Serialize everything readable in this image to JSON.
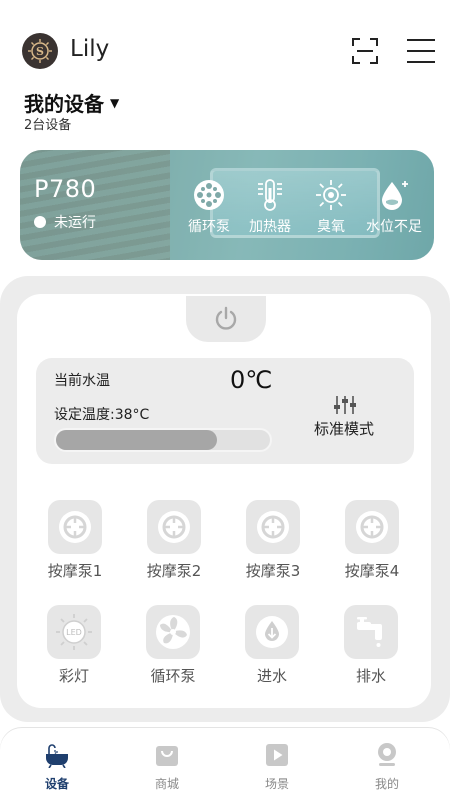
{
  "header": {
    "username": "Lily",
    "device_title": "我的设备",
    "device_count": "2台设备"
  },
  "banner": {
    "model": "P780",
    "status": "未运行",
    "stats": [
      {
        "label": "循环泵",
        "icon": "circulation-pump-icon"
      },
      {
        "label": "加热器",
        "icon": "heater-icon"
      },
      {
        "label": "臭氧",
        "icon": "ozone-icon"
      },
      {
        "label": "水位不足",
        "icon": "water-level-icon"
      }
    ]
  },
  "temperature": {
    "current_label": "当前水温",
    "current_value": "0℃",
    "set_label": "设定温度:38°C",
    "set_progress": 0.75,
    "mode_label": "标准模式"
  },
  "controls": [
    {
      "label": "按摩泵1",
      "icon": "massage-pump-icon"
    },
    {
      "label": "按摩泵2",
      "icon": "massage-pump-icon"
    },
    {
      "label": "按摩泵3",
      "icon": "massage-pump-icon"
    },
    {
      "label": "按摩泵4",
      "icon": "massage-pump-icon"
    },
    {
      "label": "彩灯",
      "icon": "led-light-icon",
      "badge": "LED"
    },
    {
      "label": "循环泵",
      "icon": "fan-icon"
    },
    {
      "label": "进水",
      "icon": "water-in-icon"
    },
    {
      "label": "排水",
      "icon": "drain-icon"
    }
  ],
  "nav": [
    {
      "label": "设备",
      "icon": "bathtub-icon",
      "active": true
    },
    {
      "label": "商城",
      "icon": "shopping-bag-icon",
      "active": false
    },
    {
      "label": "场景",
      "icon": "play-icon",
      "active": false
    },
    {
      "label": "我的",
      "icon": "profile-icon",
      "active": false
    }
  ],
  "colors": {
    "accent": "#1f3f6e",
    "panel_bg": "#ececec",
    "banner": "#86b2b0"
  }
}
